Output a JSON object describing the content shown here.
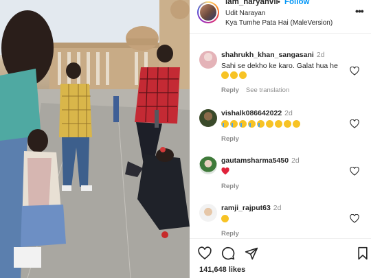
{
  "post": {
    "username": "iam_haryanvii",
    "separator": "•",
    "follow_label": "Follow",
    "audio_artist": "Udit Narayan",
    "audio_title": "Kya Tumhe Pata Hai (MaleVersion)",
    "more_label": "•••"
  },
  "comments": [
    {
      "user": "shahrukh_khan_sangasani",
      "time": "2d",
      "text": "Sahi se dekho ke karo. Galat hua he",
      "emojis": [
        "laugh",
        "laugh",
        "laugh"
      ],
      "reply": "Reply",
      "translate": "See translation"
    },
    {
      "user": "vishalk086642022",
      "time": "2d",
      "text": "",
      "emojis": [
        "cry",
        "cry",
        "cry",
        "cry",
        "cry",
        "sad",
        "sad",
        "sad",
        "sad"
      ],
      "reply": "Reply",
      "translate": ""
    },
    {
      "user": "gautamsharma5450",
      "time": "2d",
      "text": "",
      "emojis": [
        "red-heart"
      ],
      "reply": "Reply",
      "translate": ""
    },
    {
      "user": "ramji_rajput63",
      "time": "2d",
      "text": "",
      "emojis": [
        "sad"
      ],
      "reply": "Reply",
      "translate": ""
    }
  ],
  "actions": {
    "likes": "141,648 likes",
    "icons": [
      "heart-icon",
      "comment-icon",
      "share-icon",
      "bookmark-icon"
    ]
  },
  "colors": {
    "accent": "#0095f6",
    "text": "#262626",
    "muted": "#8e8e8e",
    "heart": "#ed4956"
  }
}
